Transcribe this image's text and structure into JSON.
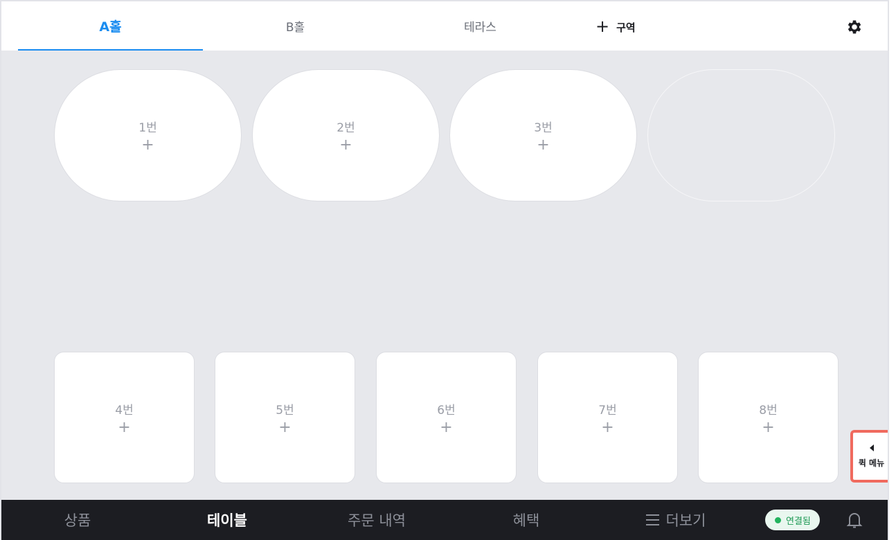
{
  "tabs": [
    "A홀",
    "B홀",
    "테라스"
  ],
  "add_zone": {
    "plus": "+",
    "label": "구역"
  },
  "oval_tables": [
    {
      "name": "1번",
      "plus": "+"
    },
    {
      "name": "2번",
      "plus": "+"
    },
    {
      "name": "3번",
      "plus": "+"
    }
  ],
  "square_tables": [
    {
      "name": "4번",
      "plus": "+"
    },
    {
      "name": "5번",
      "plus": "+"
    },
    {
      "name": "6번",
      "plus": "+"
    },
    {
      "name": "7번",
      "plus": "+"
    },
    {
      "name": "8번",
      "plus": "+"
    }
  ],
  "quick_menu": {
    "label": "퀵 메뉴"
  },
  "bottom_nav": [
    "상품",
    "테이블",
    "주문 내역",
    "혜택",
    "더보기"
  ],
  "status": {
    "label": "연결됨"
  },
  "colors": {
    "accent": "#1a8cf0",
    "nav_bg": "#1c1d22",
    "canvas_bg": "#e7e8ec",
    "quick_border": "#f06a5e",
    "connected": "#22b35e"
  }
}
